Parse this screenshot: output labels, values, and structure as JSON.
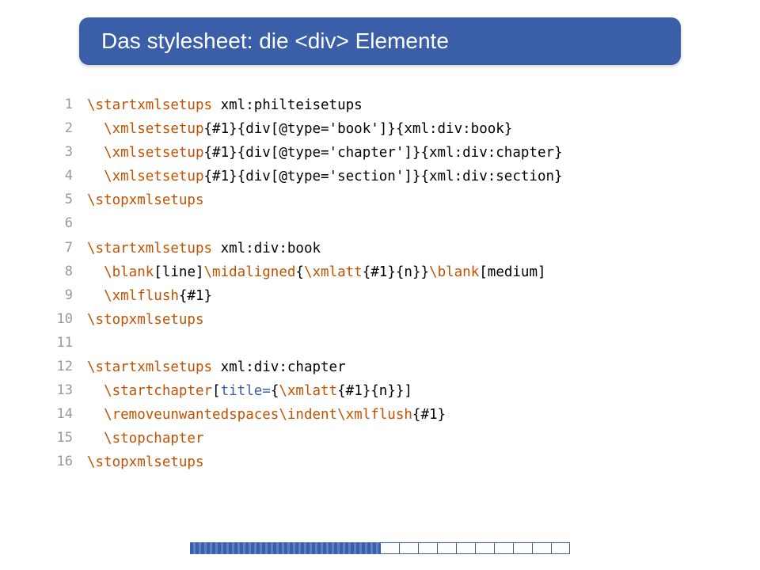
{
  "title": "Das stylesheet: die <div> Elemente",
  "lines": [
    {
      "n": "1",
      "tokens": [
        {
          "t": "\\startxmlsetups",
          "c": "cmd"
        },
        {
          "t": " xml:philteisetups",
          "c": "code"
        }
      ]
    },
    {
      "n": "2",
      "tokens": [
        {
          "t": "  ",
          "c": "code"
        },
        {
          "t": "\\xmlsetsetup",
          "c": "cmd"
        },
        {
          "t": "{#1}{div[@type='book']}{xml:div:book}",
          "c": "code"
        }
      ]
    },
    {
      "n": "3",
      "tokens": [
        {
          "t": "  ",
          "c": "code"
        },
        {
          "t": "\\xmlsetsetup",
          "c": "cmd"
        },
        {
          "t": "{#1}{div[@type='chapter']}{xml:div:chapter}",
          "c": "code"
        }
      ]
    },
    {
      "n": "4",
      "tokens": [
        {
          "t": "  ",
          "c": "code"
        },
        {
          "t": "\\xmlsetsetup",
          "c": "cmd"
        },
        {
          "t": "{#1}{div[@type='section']}{xml:div:section}",
          "c": "code"
        }
      ]
    },
    {
      "n": "5",
      "tokens": [
        {
          "t": "\\stopxmlsetups",
          "c": "cmd"
        }
      ]
    },
    {
      "n": "6",
      "tokens": []
    },
    {
      "n": "7",
      "tokens": [
        {
          "t": "\\startxmlsetups",
          "c": "cmd"
        },
        {
          "t": " xml:div:book",
          "c": "code"
        }
      ]
    },
    {
      "n": "8",
      "tokens": [
        {
          "t": "  ",
          "c": "code"
        },
        {
          "t": "\\blank",
          "c": "cmd"
        },
        {
          "t": "[line]",
          "c": "code"
        },
        {
          "t": "\\midaligned",
          "c": "cmd"
        },
        {
          "t": "{",
          "c": "code"
        },
        {
          "t": "\\xmlatt",
          "c": "cmd"
        },
        {
          "t": "{#1}{n}}",
          "c": "code"
        },
        {
          "t": "\\blank",
          "c": "cmd"
        },
        {
          "t": "[medium]",
          "c": "code"
        }
      ]
    },
    {
      "n": "9",
      "tokens": [
        {
          "t": "  ",
          "c": "code"
        },
        {
          "t": "\\xmlflush",
          "c": "cmd"
        },
        {
          "t": "{#1}",
          "c": "code"
        }
      ]
    },
    {
      "n": "10",
      "tokens": [
        {
          "t": "\\stopxmlsetups",
          "c": "cmd"
        }
      ]
    },
    {
      "n": "11",
      "tokens": []
    },
    {
      "n": "12",
      "tokens": [
        {
          "t": "\\startxmlsetups",
          "c": "cmd"
        },
        {
          "t": " xml:div:chapter",
          "c": "code"
        }
      ]
    },
    {
      "n": "13",
      "tokens": [
        {
          "t": "  ",
          "c": "code"
        },
        {
          "t": "\\startchapter",
          "c": "cmd"
        },
        {
          "t": "[",
          "c": "code"
        },
        {
          "t": "title=",
          "c": "key"
        },
        {
          "t": "{",
          "c": "code"
        },
        {
          "t": "\\xmlatt",
          "c": "cmd"
        },
        {
          "t": "{#1}{n}}]",
          "c": "code"
        }
      ]
    },
    {
      "n": "14",
      "tokens": [
        {
          "t": "  ",
          "c": "code"
        },
        {
          "t": "\\removeunwantedspaces\\indent\\xmlflush",
          "c": "cmd"
        },
        {
          "t": "{#1}",
          "c": "code"
        }
      ]
    },
    {
      "n": "15",
      "tokens": [
        {
          "t": "  ",
          "c": "code"
        },
        {
          "t": "\\stopchapter",
          "c": "cmd"
        }
      ]
    },
    {
      "n": "16",
      "tokens": [
        {
          "t": "\\stopxmlsetups",
          "c": "cmd"
        }
      ]
    }
  ]
}
